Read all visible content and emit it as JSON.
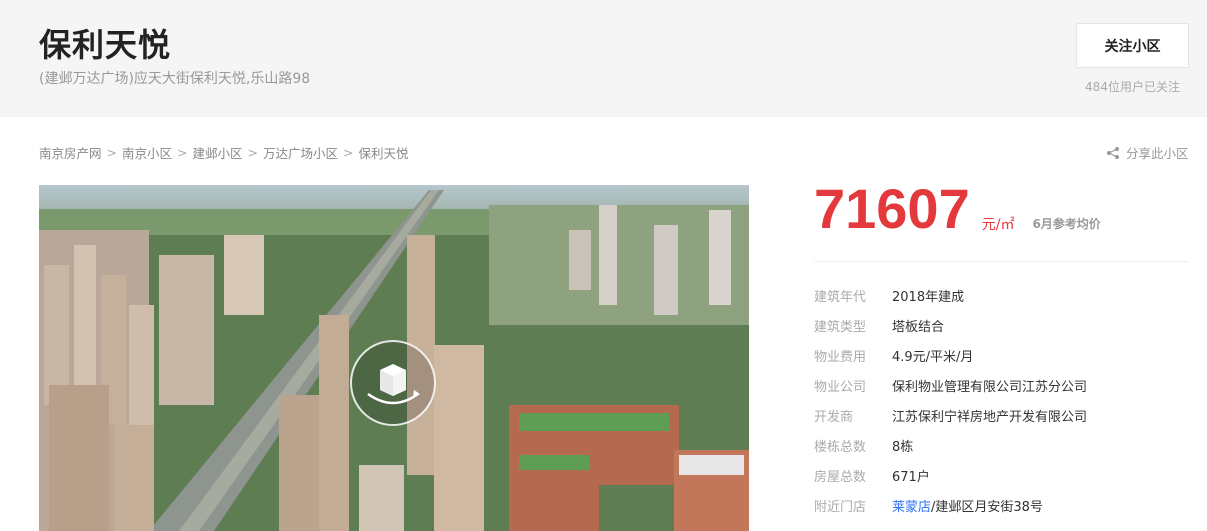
{
  "header": {
    "title": "保利天悦",
    "address": "(建邺万达广场)应天大街保利天悦,乐山路98",
    "follow_label": "关注小区",
    "follow_count": "484位用户已关注"
  },
  "breadcrumb": [
    "南京房产网",
    "南京小区",
    "建邺小区",
    "万达广场小区",
    "保利天悦"
  ],
  "share_label": "分享此小区",
  "price": {
    "value": "71607",
    "unit": "元/㎡",
    "note": "6月参考均价"
  },
  "info": [
    {
      "label": "建筑年代",
      "value": "2018年建成"
    },
    {
      "label": "建筑类型",
      "value": "塔板结合"
    },
    {
      "label": "物业费用",
      "value": "4.9元/平米/月"
    },
    {
      "label": "物业公司",
      "value": "保利物业管理有限公司江苏分公司"
    },
    {
      "label": "开发商",
      "value": "江苏保利宁祥房地产开发有限公司"
    },
    {
      "label": "楼栋总数",
      "value": "8栋"
    },
    {
      "label": "房屋总数",
      "value": "671户"
    },
    {
      "label": "附近门店",
      "value_link": "莱蒙店",
      "value_rest": "/建邺区月安街38号"
    }
  ],
  "colors": {
    "price": "#e4393c",
    "link": "#3072f6",
    "header_bg": "#f5f5f5"
  }
}
